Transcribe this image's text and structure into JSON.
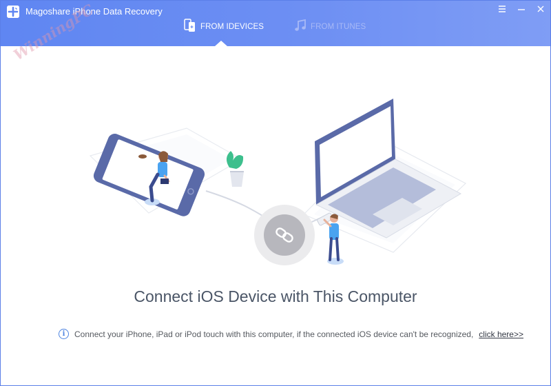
{
  "window": {
    "title": "Magoshare iPhone Data Recovery",
    "controls": {
      "menu_icon": "menu-icon",
      "minimize_icon": "minimize-icon",
      "close_icon": "close-icon"
    }
  },
  "tabs": [
    {
      "label": "FROM IDEVICES",
      "icon": "device-copy-icon",
      "active": true
    },
    {
      "label": "FROM ITUNES",
      "icon": "music-note-icon",
      "active": false
    }
  ],
  "watermark": {
    "text": "WinningPC"
  },
  "main": {
    "headline": "Connect iOS Device with This Computer",
    "info_text": "Connect your iPhone, iPad or iPod touch with this computer, if the connected iOS device can't be recognized,",
    "link_text": "click here>>"
  },
  "colors": {
    "header_start": "#5f86f2",
    "header_end": "#7f9df5",
    "accent": "#4d83e0",
    "text": "#4a5566"
  }
}
